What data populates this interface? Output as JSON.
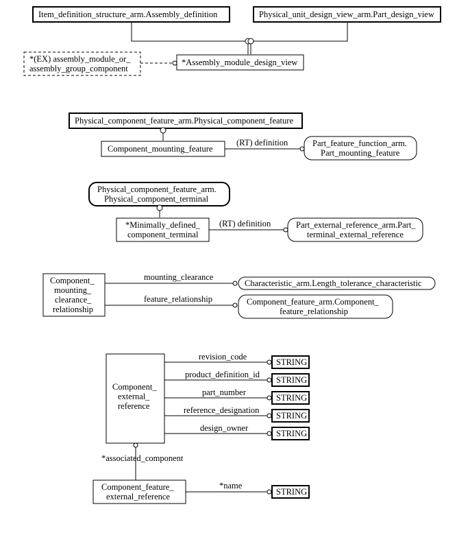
{
  "diagram": {
    "section1": {
      "top_left": "Item_definition_structure_arm.Assembly_definition",
      "top_right": "Physical_unit_design_view_arm.Part_design_view",
      "dashed_l1": "*(EX) assembly_module_or_",
      "dashed_l2": "assembly_group_component",
      "center": "*Assembly_module_design_view"
    },
    "section2": {
      "top": "Physical_component_feature_arm.Physical_component_feature",
      "child": "Component_mounting_feature",
      "edge": "(RT) definition",
      "right_l1": "Part_feature_function_arm.",
      "right_l2": "Part_mounting_feature"
    },
    "section3": {
      "top_l1": "Physical_component_feature_arm.",
      "top_l2": "Physical_component_terminal",
      "child_l1": "*Minimally_defined_",
      "child_l2": "component_terminal",
      "edge": "(RT) definition",
      "right_l1": "Part_external_reference_arm.Part_",
      "right_l2": "terminal_external_reference"
    },
    "section4": {
      "left_l1": "Component_",
      "left_l2": "mounting_",
      "left_l3": "clearance_",
      "left_l4": "relationship",
      "edge1": "mounting_clearance",
      "right1": "Characteristic_arm.Length_tolerance_characteristic",
      "edge2": "feature_relationship",
      "right2_l1": "Component_feature_arm.Component_",
      "right2_l2": "feature_relationship"
    },
    "section5": {
      "left_l1": "Component_",
      "left_l2": "external_",
      "left_l3": "reference",
      "attrs": [
        {
          "label": "revision_code",
          "type": "STRING"
        },
        {
          "label": "product_definition_id",
          "type": "STRING"
        },
        {
          "label": "part_number",
          "type": "STRING"
        },
        {
          "label": "reference_designation",
          "type": "STRING"
        },
        {
          "label": "design_owner",
          "type": "STRING"
        }
      ],
      "assoc_edge": "*associated_component",
      "bottom_l1": "Component_feature_",
      "bottom_l2": "external_reference",
      "bottom_edge": "*name",
      "bottom_type": "STRING"
    }
  }
}
